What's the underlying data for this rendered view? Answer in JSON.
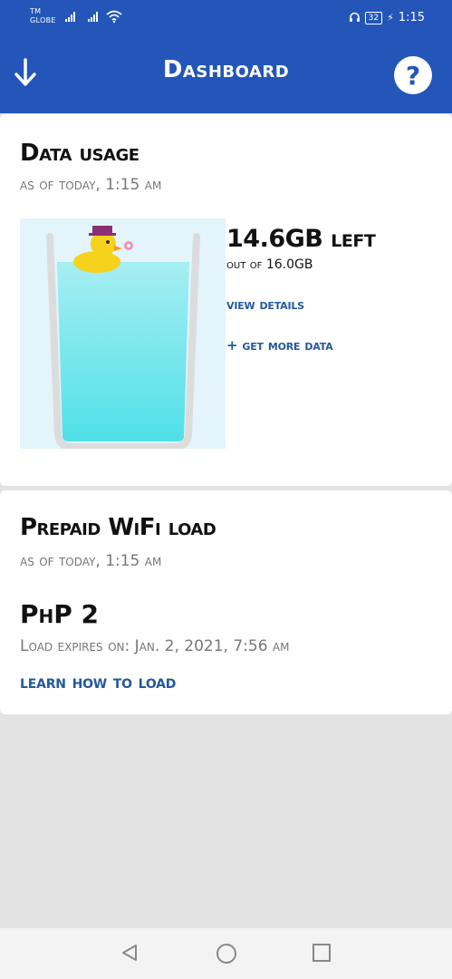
{
  "status": {
    "carrier_mark": "TM",
    "carrier_name": "GLOBE",
    "battery": "32",
    "time": "1:15"
  },
  "appbar": {
    "title": "Dashboard"
  },
  "data_usage": {
    "title": "Data usage",
    "as_of": "as of today, 1:15 am",
    "left": "14.6GB left",
    "total": "out of 16.0GB",
    "view_details": "view details",
    "get_more": "+ get more data",
    "fill_fraction": 0.78
  },
  "wifi_load": {
    "title": "Prepaid WiFi load",
    "as_of": "as of today, 1:15 am",
    "amount": "PhP 2",
    "expires": "Load expires on: Jan. 2, 2021, 7:56 am",
    "learn_link": "learn how to load"
  },
  "colors": {
    "brand_blue": "#2356b8",
    "link_blue": "#24589f",
    "water": "#a8f1f4"
  }
}
